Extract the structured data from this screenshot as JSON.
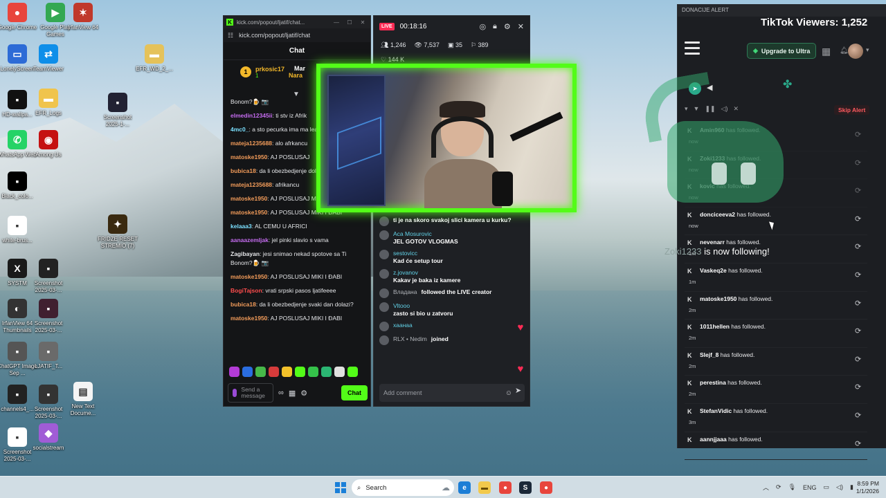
{
  "desktop_icons": [
    {
      "label": "Google Chrome",
      "color": "#e8453c",
      "glyph": "●"
    },
    {
      "label": "Google Play Games",
      "color": "#33a852",
      "glyph": "▶"
    },
    {
      "label": "IrfanView 64",
      "color": "#c0392b",
      "glyph": "✶"
    },
    {
      "label": "LonelyScreen",
      "color": "#2d6bd6",
      "glyph": "▭"
    },
    {
      "label": "TeamViewer",
      "color": "#0e8ee9",
      "glyph": "⇄"
    },
    {
      "label": "EFR_WD_2_...",
      "color": "#e5c25a",
      "glyph": "▬"
    },
    {
      "label": "HD-wallpa...",
      "color": "#111",
      "glyph": "▪"
    },
    {
      "label": "EFR_Logs",
      "color": "#f0c44c",
      "glyph": "▬"
    },
    {
      "label": "Screenshot 2025-1-...",
      "color": "#223",
      "glyph": "▪"
    },
    {
      "label": "WhatsApp Web",
      "color": "#25d366",
      "glyph": "✆"
    },
    {
      "label": "Among Us",
      "color": "#c51111",
      "glyph": "◉"
    },
    {
      "label": "Black_colo...",
      "color": "#000",
      "glyph": "▪"
    },
    {
      "label": "white-brus...",
      "color": "#fff",
      "glyph": "▪"
    },
    {
      "label": "FRIDZE RESET STREMIO (7)",
      "color": "#3a2a10",
      "glyph": "✦"
    },
    {
      "label": "SYSTM",
      "color": "#1a1a1a",
      "glyph": "X"
    },
    {
      "label": "Screenshot 2025-03-...",
      "color": "#222",
      "glyph": "▪"
    },
    {
      "label": "IrfanView 64 Thumbnails",
      "color": "#333",
      "glyph": "◐"
    },
    {
      "label": "Screenshot 2025-03-...",
      "color": "#402030",
      "glyph": "▪"
    },
    {
      "label": "ChatGPT Image Sep ...",
      "color": "#555",
      "glyph": "▪"
    },
    {
      "label": "LJATIF_T...",
      "color": "#6a6a6a",
      "glyph": "▪"
    },
    {
      "label": "channels4_...",
      "color": "#222",
      "glyph": "▪"
    },
    {
      "label": "Screenshot 2025-03-...",
      "color": "#333",
      "glyph": "▪"
    },
    {
      "label": "New Text Docume...",
      "color": "#f4f4f4",
      "glyph": "▤"
    },
    {
      "label": "Screenshot 2025-03-...",
      "color": "#fff",
      "glyph": "▪"
    },
    {
      "label": "socialstream",
      "color": "#a05cd6",
      "glyph": "◆"
    }
  ],
  "kick": {
    "window_title": "kick.com/popout/ljatif/chat...",
    "url": "kick.com/popout/ljatif/chat",
    "header": "Chat",
    "pinned": {
      "rank": "1",
      "user": "prkosic17",
      "sub": "1",
      "user2": "Mar",
      "user3": "Nara"
    },
    "messages": [
      {
        "user": "",
        "color": "#e6e7ea",
        "text": "Bonom?🍺 📷"
      },
      {
        "user": "elmedin12345ii",
        "color": "#c56cf0",
        "text": ": ti stv iz Afrik"
      },
      {
        "user": "4mc0_",
        "color": "#7be0ff",
        "text": ": a sto pecurka ima ma leakovan nekontam"
      },
      {
        "user": "mateja1235688",
        "color": "#f39c5a",
        "text": ": alo afrkancu"
      },
      {
        "user": "matoske1950",
        "color": "#f39c5a",
        "text": ": AJ POSLUSAJ"
      },
      {
        "user": "bubica18",
        "color": "#f39c5a",
        "text": ": da li obezbedjenje dolazi?"
      },
      {
        "user": "mateja1235688",
        "color": "#f39c5a",
        "text": ": afrikancu"
      },
      {
        "user": "matoske1950",
        "color": "#f39c5a",
        "text": ": AJ POSLUSAJ MIKI I ĐABI"
      },
      {
        "user": "matoske1950",
        "color": "#f39c5a",
        "text": ": AJ POSLUSAJ MIKI I ĐABI"
      },
      {
        "user": "kelaaa3",
        "color": "#7be0ff",
        "text": ": AL CEMU U AFRICI"
      },
      {
        "user": "aanaazemljak",
        "color": "#c56cf0",
        "text": ": jel pinki slavio s vama"
      },
      {
        "user": "Zagibayan",
        "color": "#e6e7ea",
        "text": ": jesi snimao nekad spotove sa Ti Bonom?🍺 📷"
      },
      {
        "user": "matoske1950",
        "color": "#f39c5a",
        "text": ": AJ POSLUSAJ MIKI I ĐABI"
      },
      {
        "user": "BogiTajson",
        "color": "#ff4d4d",
        "text": ": vrati srpski pasos ljatifeeee"
      },
      {
        "user": "bubica18",
        "color": "#f39c5a",
        "text": ": da li obezbedjenje svaki dan dolazi?"
      },
      {
        "user": "matoske1950",
        "color": "#f39c5a",
        "text": ": AJ POSLUSAJ MIKI I ĐABI"
      }
    ],
    "input_placeholder": "Send a message",
    "chat_button": "Chat"
  },
  "tiktok": {
    "live_badge": "LIVE",
    "timer": "00:18:16",
    "stats": {
      "viewers": "1,246",
      "views": "7,537",
      "gifts": "35",
      "members": "389"
    },
    "likes": "144 K",
    "comments": [
      {
        "name": "",
        "text": "ti je na skoro svakoj slici kamera u kurku?"
      },
      {
        "name": "Aca Mosurovic",
        "text": "JEL GOTOV VLOGMAS"
      },
      {
        "name": "sestovicc",
        "text": "Kad će setup tour"
      },
      {
        "name": "z.jovanov",
        "text": "Kakav je baka iz kamere"
      },
      {
        "name": "Владана",
        "text": "followed the LIVE creator",
        "system": true
      },
      {
        "name": "Vltooo",
        "text": "zasto si bio u zatvoru"
      },
      {
        "name": "хаанаа",
        "text": ""
      },
      {
        "name": "RLX • Nedim",
        "text": "joined",
        "system": true
      }
    ],
    "comment_placeholder": "Add comment"
  },
  "alerts": {
    "window_title": "DONACIJE ALERT",
    "viewers_label": "TikTok Viewers: 1,252",
    "upgrade_label": "Upgrade to Ultra",
    "skip_label": "Skip Alert",
    "follow_overlay_name": "Zoki1233",
    "follow_overlay_text": " is now following!",
    "feed": [
      {
        "user": "Amin960",
        "action": "has followed.",
        "time": "now",
        "dim": true
      },
      {
        "user": "Zoki1233",
        "action": "has followed.",
        "time": "now",
        "dim": true
      },
      {
        "user": "kovic",
        "action": "has followed.",
        "time": "now",
        "dim": true
      },
      {
        "user": "donciceeva2",
        "action": "has followed.",
        "time": "now"
      },
      {
        "user": "nevenarr",
        "action": "has followed.",
        "time": "1m"
      },
      {
        "user": "Vaskeq2e",
        "action": "has followed.",
        "time": "1m"
      },
      {
        "user": "matoske1950",
        "action": "has followed.",
        "time": "2m"
      },
      {
        "user": "1011hellen",
        "action": "has followed.",
        "time": "2m"
      },
      {
        "user": "Slejf_8",
        "action": "has followed.",
        "time": "2m"
      },
      {
        "user": "perestina",
        "action": "has followed.",
        "time": "2m"
      },
      {
        "user": "StefanVidic",
        "action": "has followed.",
        "time": "3m"
      },
      {
        "user": "aannjjaaa",
        "action": "has followed.",
        "time": ""
      }
    ]
  },
  "taskbar": {
    "search_placeholder": "Search",
    "lang": "ENG",
    "time": "8:59 PM",
    "date": "1/1/2026"
  }
}
